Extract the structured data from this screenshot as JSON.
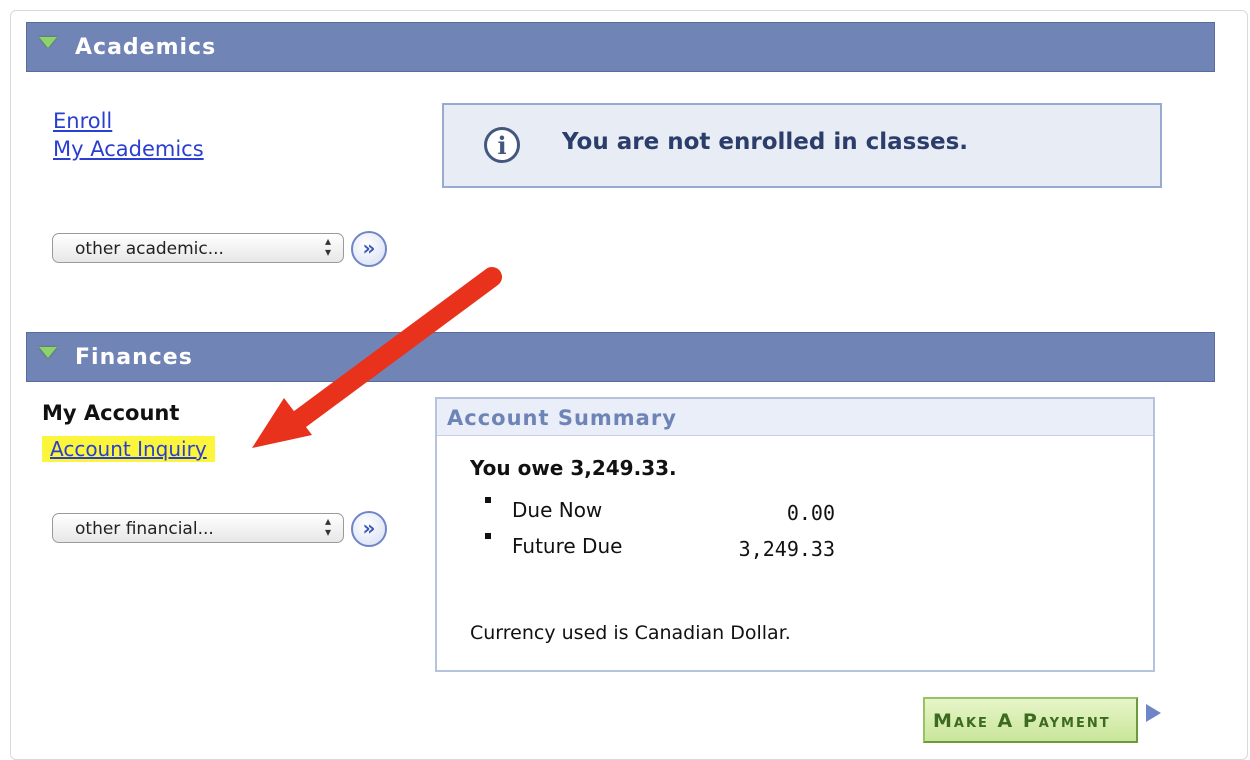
{
  "academics": {
    "title": "Academics",
    "links": [
      "Enroll",
      "My Academics"
    ],
    "info_message": "You are not enrolled in classes.",
    "select_value": "other academic..."
  },
  "finances": {
    "title": "Finances",
    "my_account_label": "My Account",
    "account_inquiry_link": "Account Inquiry",
    "select_value": "other financial...",
    "summary": {
      "title": "Account Summary",
      "owe_text": "You owe 3,249.33.",
      "rows": [
        {
          "label": "Due Now",
          "value": "0.00"
        },
        {
          "label": "Future Due",
          "value": "3,249.33"
        }
      ],
      "currency_text": "Currency used is Canadian Dollar."
    },
    "payment_button": "Make A Payment"
  },
  "icons": {
    "section_toggle": "triangle-down-icon",
    "info": "info-icon",
    "go": "double-chevron-right-icon",
    "payment_arrow": "triangle-right-icon"
  },
  "colors": {
    "section_bar": "#7184b6",
    "link": "#2a3fd0",
    "highlight": "#fbf53c",
    "annotation_arrow": "#e8321c",
    "payment_button": "#c9e69a"
  }
}
